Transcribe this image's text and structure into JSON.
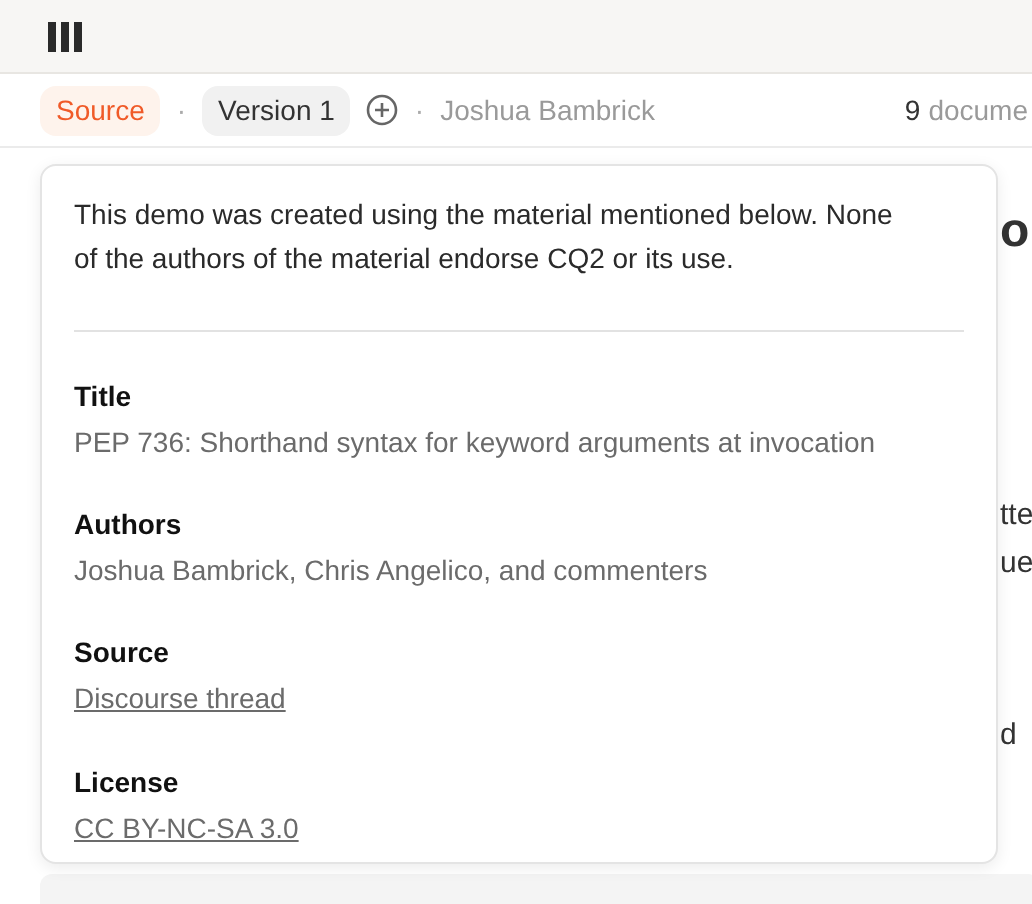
{
  "meta_bar": {
    "source_badge": "Source",
    "separator_1": "·",
    "version_badge": "Version 1",
    "separator_2": "·",
    "author": "Joshua Bambrick",
    "count": "9",
    "count_label": "docume"
  },
  "background_fragments": [
    {
      "kind": "heading",
      "text": "o"
    },
    {
      "kind": "text",
      "text": "tte"
    },
    {
      "kind": "text",
      "text": "ue"
    },
    {
      "kind": "text",
      "text": "d"
    }
  ],
  "popover": {
    "intro": "This demo was created using the material mentioned below. None of the authors of the material endorse CQ2 or its use.",
    "sections": [
      {
        "label": "Title",
        "kind": "text",
        "value": "PEP 736: Shorthand syntax for keyword arguments at invocation"
      },
      {
        "label": "Authors",
        "kind": "text",
        "value": "Joshua Bambrick, Chris Angelico, and commenters"
      },
      {
        "label": "Source",
        "kind": "link",
        "value": "Discourse thread"
      },
      {
        "label": "License",
        "kind": "link",
        "value": "CC BY-NC-SA 3.0"
      }
    ]
  }
}
